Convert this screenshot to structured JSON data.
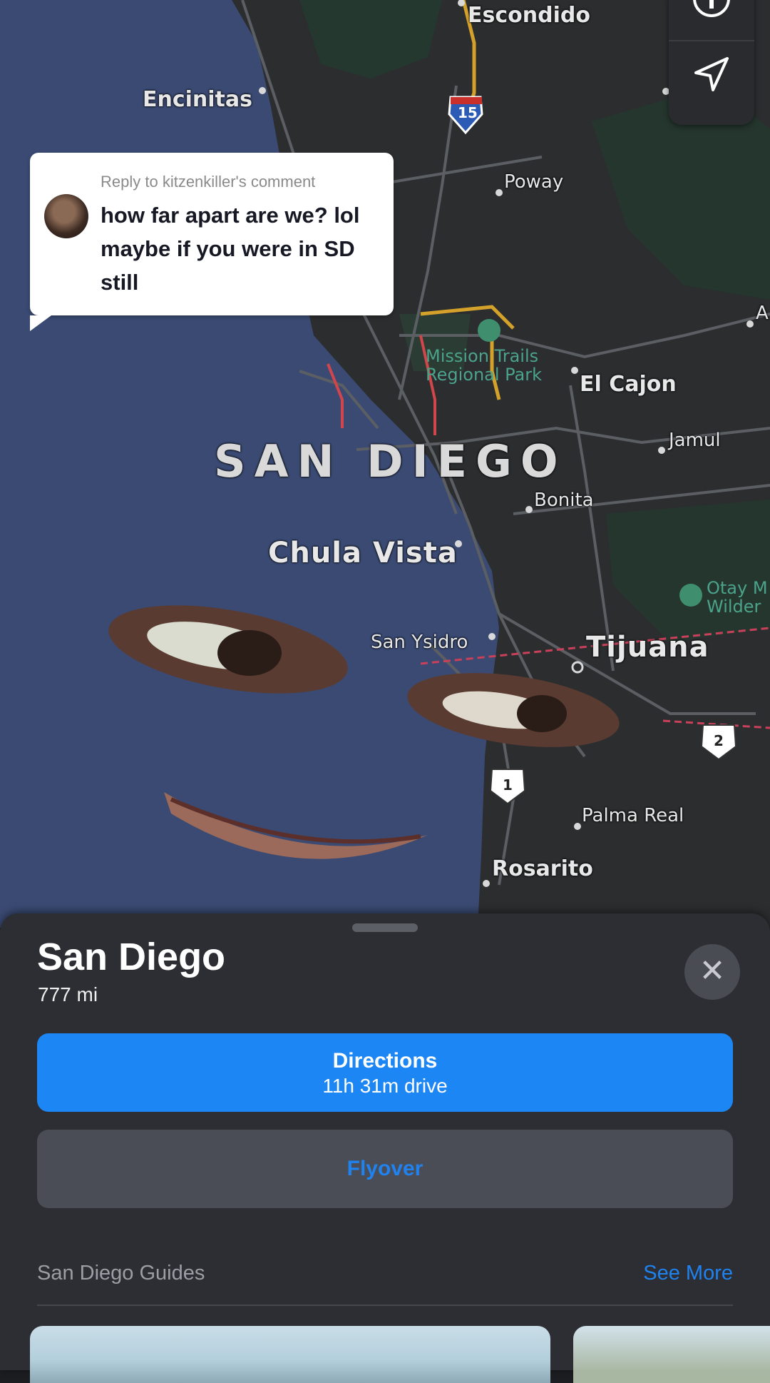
{
  "map": {
    "labels": {
      "escondido": "Escondido",
      "encinitas": "Encinitas",
      "poway": "Poway",
      "mission_trails_1": "Mission Trails",
      "mission_trails_2": "Regional Park",
      "el_cajon": "El Cajon",
      "jamul": "Jamul",
      "san_diego": "SAN DIEGO",
      "bonita": "Bonita",
      "chula_vista": "Chula Vista",
      "otay_1": "Otay M",
      "otay_2": "Wilder",
      "san_ysidro": "San Ysidro",
      "tijuana": "Tijuana",
      "palma_real": "Palma Real",
      "rosarito": "Rosarito",
      "edge_a": "A"
    },
    "shields": {
      "i15": "15",
      "r1": "1",
      "r2": "2"
    },
    "colors": {
      "ocean": "#3a4a73",
      "land": "#2b2d2f",
      "roads": "#5b5e63",
      "highway": "#d4a12a"
    }
  },
  "map_controls": {
    "info_icon": "info-icon",
    "location_icon": "location-arrow-icon"
  },
  "comment": {
    "reply_to": "Reply to kitzenkiller's comment",
    "message": "how far apart are we? lol maybe if you were in SD still"
  },
  "place_card": {
    "title": "San Diego",
    "distance": "777 mi",
    "close_icon": "close-icon",
    "directions_label": "Directions",
    "directions_time": "11h 31m drive",
    "flyover_label": "Flyover",
    "guides_label": "San Diego Guides",
    "see_more_label": "See More"
  },
  "colors": {
    "accent": "#1d86f5",
    "sheet": "#2c2e33"
  }
}
